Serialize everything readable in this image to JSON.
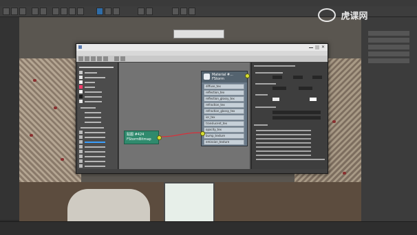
{
  "watermark": {
    "brand_text": "虎课网"
  },
  "material_node": {
    "title": "Material #...",
    "subtitle": "FStorm",
    "slots": [
      "diffuse_tex",
      "reflection_tex",
      "reflection_glossy_tex",
      "refraction_tex",
      "refraction_glossy_tex",
      "ior_tex",
      "translucent_tex",
      "opacity_tex",
      "bump_texture",
      "emission_texture"
    ]
  },
  "bitmap_node": {
    "label_line1": "贴图 #424",
    "label_line2": "FStormBitmap"
  },
  "colors": {
    "node_bitmap": "#2f8a6d",
    "node_material": "#6b7b8a",
    "link": "#d9303a",
    "port": "#d8e033"
  },
  "icons": [
    "max-logo-icon",
    "play-icon",
    "grid-icon",
    "material-editor-icon",
    "render-icon"
  ]
}
